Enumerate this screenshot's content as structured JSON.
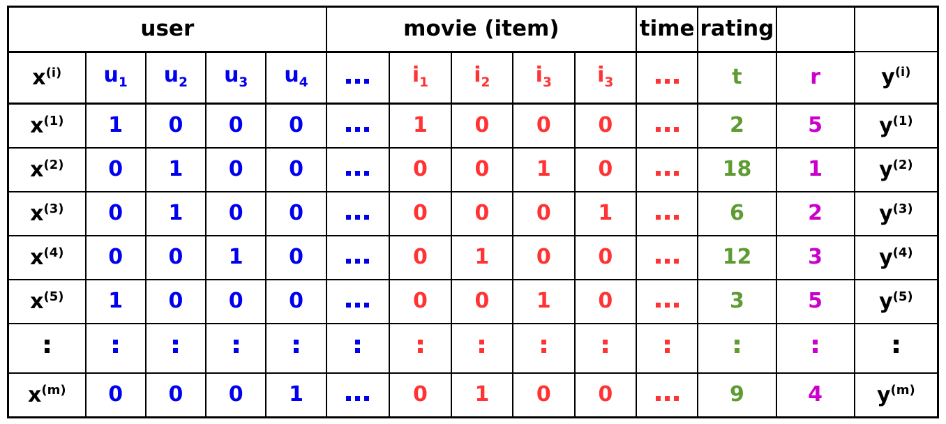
{
  "table": {
    "group_headers": [
      {
        "label": "user",
        "span": 5
      },
      {
        "label": "movie (item)",
        "span": 5
      },
      {
        "label": "time",
        "span": 1
      },
      {
        "label": "rating",
        "span": 1
      },
      {
        "label": "",
        "span": 1
      }
    ],
    "column_headers": [
      {
        "base": "x",
        "sup": "(i)",
        "color": "#000000"
      },
      {
        "base": "u",
        "sub": "1",
        "color": "#0000ee"
      },
      {
        "base": "u",
        "sub": "2",
        "color": "#0000ee"
      },
      {
        "base": "u",
        "sub": "3",
        "color": "#0000ee"
      },
      {
        "base": "u",
        "sub": "4",
        "color": "#0000ee"
      },
      {
        "base": "ellipsis",
        "color": "#0000ee"
      },
      {
        "base": "i",
        "sub": "1",
        "color": "#ff3333"
      },
      {
        "base": "i",
        "sub": "2",
        "color": "#ff3333"
      },
      {
        "base": "i",
        "sub": "3",
        "color": "#ff3333"
      },
      {
        "base": "i",
        "sub": "3",
        "color": "#ff3333"
      },
      {
        "base": "ellipsis",
        "color": "#ff3333"
      },
      {
        "base": "t",
        "color": "#5f9b33"
      },
      {
        "base": "r",
        "color": "#cc00cc"
      },
      {
        "base": "y",
        "sup": "(i)",
        "color": "#000000"
      }
    ],
    "header_labels_flat": [
      "x(i)",
      "u1",
      "u2",
      "u3",
      "u4",
      "...",
      "i1",
      "i2",
      "i3",
      "i3",
      "...",
      "t",
      "r",
      "y(i)"
    ],
    "rows": [
      {
        "index": "1",
        "row_label": {
          "base": "x",
          "sup": "(1)"
        },
        "user": [
          "1",
          "0",
          "0",
          "0"
        ],
        "user_more": "...",
        "item": [
          "1",
          "0",
          "0",
          "0"
        ],
        "item_more": "...",
        "time": "2",
        "rating": "5",
        "target": {
          "base": "y",
          "sup": "(1)"
        }
      },
      {
        "index": "2",
        "row_label": {
          "base": "x",
          "sup": "(2)"
        },
        "user": [
          "0",
          "1",
          "0",
          "0"
        ],
        "user_more": "...",
        "item": [
          "0",
          "0",
          "1",
          "0"
        ],
        "item_more": "...",
        "time": "18",
        "rating": "1",
        "target": {
          "base": "y",
          "sup": "(2)"
        }
      },
      {
        "index": "3",
        "row_label": {
          "base": "x",
          "sup": "(3)"
        },
        "user": [
          "0",
          "1",
          "0",
          "0"
        ],
        "user_more": "...",
        "item": [
          "0",
          "0",
          "0",
          "1"
        ],
        "item_more": "...",
        "time": "6",
        "rating": "2",
        "target": {
          "base": "y",
          "sup": "(3)"
        }
      },
      {
        "index": "4",
        "row_label": {
          "base": "x",
          "sup": "(4)"
        },
        "user": [
          "0",
          "0",
          "1",
          "0"
        ],
        "user_more": "...",
        "item": [
          "0",
          "1",
          "0",
          "0"
        ],
        "item_more": "...",
        "time": "12",
        "rating": "3",
        "target": {
          "base": "y",
          "sup": "(4)"
        }
      },
      {
        "index": "5",
        "row_label": {
          "base": "x",
          "sup": "(5)"
        },
        "user": [
          "1",
          "0",
          "0",
          "0"
        ],
        "user_more": "...",
        "item": [
          "0",
          "0",
          "1",
          "0"
        ],
        "item_more": "...",
        "time": "3",
        "rating": "5",
        "target": {
          "base": "y",
          "sup": "(5)"
        }
      },
      {
        "index": "vdots",
        "is_ellipsis_row": true,
        "row_label": {
          "base": "vdots"
        },
        "user": [
          ":",
          ":",
          ":",
          ":"
        ],
        "user_more": ":",
        "item": [
          ":",
          ":",
          ":",
          ":"
        ],
        "item_more": ":",
        "time": ":",
        "rating": ":",
        "target": {
          "base": "vdots"
        }
      },
      {
        "index": "m",
        "row_label": {
          "base": "x",
          "sup": "(m)"
        },
        "user": [
          "0",
          "0",
          "0",
          "1"
        ],
        "user_more": "...",
        "item": [
          "0",
          "1",
          "0",
          "0"
        ],
        "item_more": "...",
        "time": "9",
        "rating": "4",
        "target": {
          "base": "y",
          "sup": "(m)"
        }
      }
    ]
  },
  "colors": {
    "black": "#000000",
    "user_blue": "#0000ee",
    "item_red": "#ff3333",
    "time_green": "#5f9b33",
    "rating_magenta": "#cc00cc",
    "border": "#000000",
    "background": "#ffffff"
  }
}
